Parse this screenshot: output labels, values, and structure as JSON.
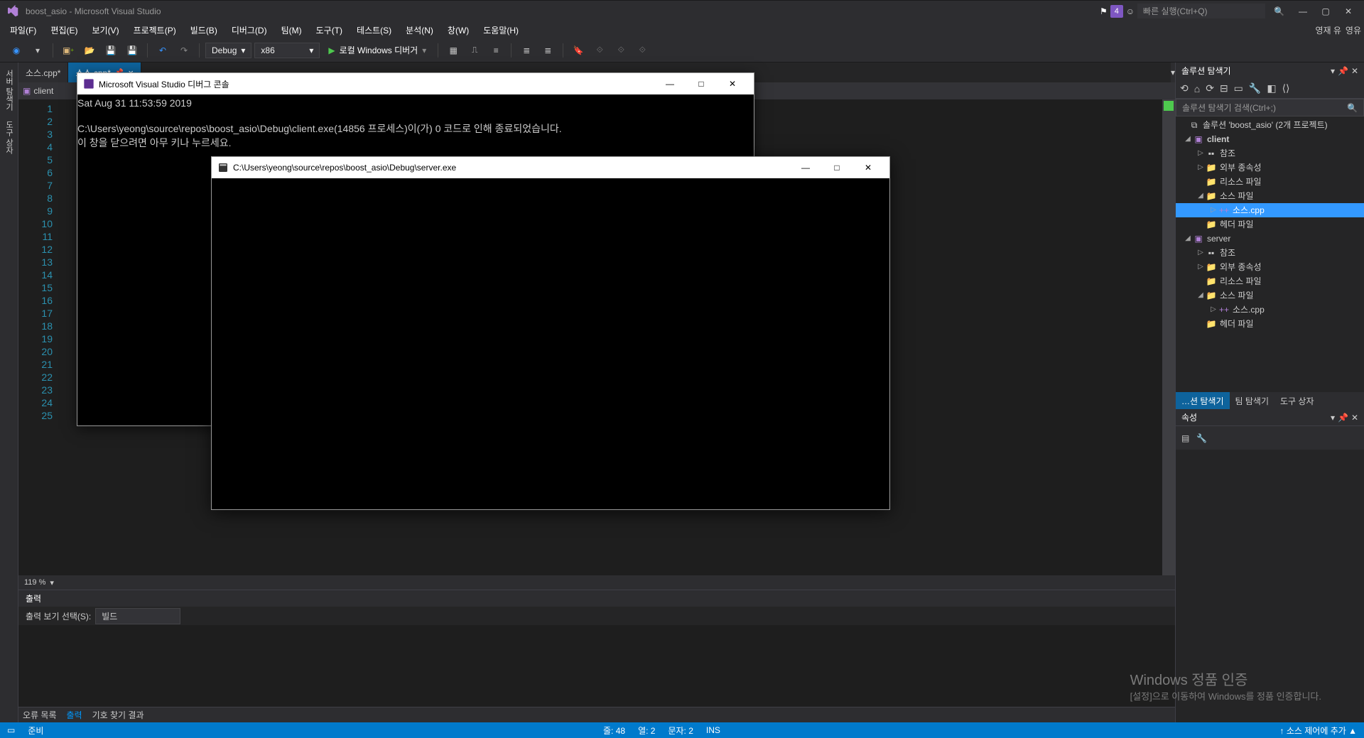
{
  "title": "boost_asio - Microsoft Visual Studio",
  "notif_count": "4",
  "quicklaunch_placeholder": "빠른 실행(Ctrl+Q)",
  "user_name": "영재 유",
  "user_badge": "영유",
  "menu": {
    "file": "파일(F)",
    "edit": "편집(E)",
    "view": "보기(V)",
    "project": "프로젝트(P)",
    "build": "빌드(B)",
    "debug": "디버그(D)",
    "team": "팀(M)",
    "tools": "도구(T)",
    "test": "테스트(S)",
    "analyze": "분석(N)",
    "window": "창(W)",
    "help": "도움말(H)"
  },
  "toolbar": {
    "config": "Debug",
    "platform": "x86",
    "run_label": "로컬 Windows 디버거"
  },
  "left_tabs": {
    "server_explorer": "서버 탐색기",
    "toolbox": "도구 상자"
  },
  "doc_tabs": {
    "tab1": "소스.cpp*",
    "tab2": "소스.cpp*"
  },
  "navbar": {
    "scope": "client"
  },
  "gutter_lines": [
    "1",
    "2",
    "3",
    "4",
    "5",
    "6",
    "7",
    "8",
    "9",
    "10",
    "11",
    "12",
    "13",
    "14",
    "15",
    "16",
    "17",
    "18",
    "19",
    "20",
    "21",
    "22",
    "23",
    "24",
    "25"
  ],
  "zoom": "119 %",
  "output": {
    "title": "출력",
    "show_label": "출력 보기 선택(S):",
    "show_value": "빌드"
  },
  "bottom_tabs": {
    "error_list": "오류 목록",
    "output": "출력",
    "find_results": "기호 찾기 결과"
  },
  "solution_explorer": {
    "title": "솔루션 탐색기",
    "search_placeholder": "솔루션 탐색기 검색(Ctrl+;)",
    "root": "솔루션 'boost_asio' (2개 프로젝트)",
    "p1": "client",
    "p1_refs": "참조",
    "p1_ext": "외부 종속성",
    "p1_res": "리소스 파일",
    "p1_src": "소스 파일",
    "p1_src_f": "소스.cpp",
    "p1_hdr": "헤더 파일",
    "p2": "server",
    "p2_refs": "참조",
    "p2_ext": "외부 종속성",
    "p2_res": "리소스 파일",
    "p2_src": "소스 파일",
    "p2_src_f": "소스.cpp",
    "p2_hdr": "헤더 파일"
  },
  "pane_tabs": {
    "soln": "…션 탐색기",
    "team": "팀 탐색기",
    "toolbox": "도구 상자"
  },
  "properties": {
    "title": "속성"
  },
  "statusbar": {
    "ready": "준비",
    "line": "줄: 48",
    "col": "열: 2",
    "ch": "문자: 2",
    "ins": "INS",
    "source_control": "소스 제어에 추가 ▲"
  },
  "console1": {
    "title": "Microsoft Visual Studio 디버그 콘솔",
    "line1": "Sat Aug 31 11:53:59 2019",
    "line2": "",
    "line3": "C:\\Users\\yeong\\source\\repos\\boost_asio\\Debug\\client.exe(14856 프로세스)이(가) 0 코드로 인해 종료되었습니다.",
    "line4": "이 창을 닫으려면 아무 키나 누르세요."
  },
  "console2": {
    "title": "C:\\Users\\yeong\\source\\repos\\boost_asio\\Debug\\server.exe"
  },
  "watermark": {
    "l1": "Windows 정품 인증",
    "l2": "[설정]으로 이동하여 Windows를 정품 인증합니다."
  }
}
